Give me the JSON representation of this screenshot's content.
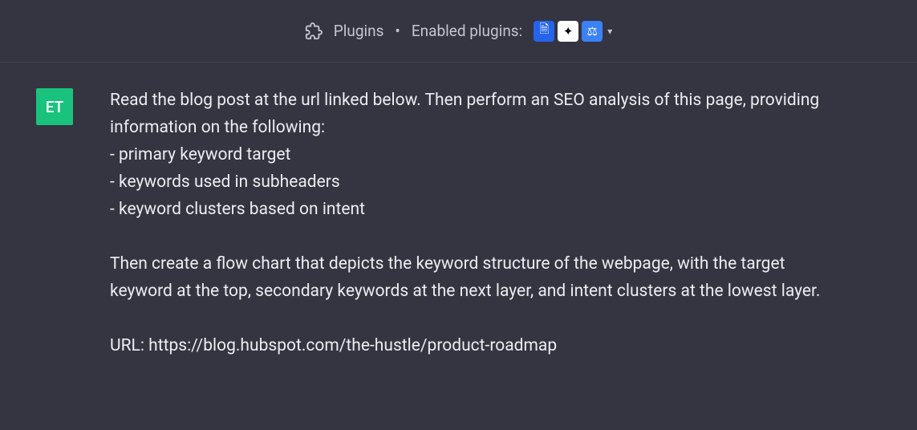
{
  "header": {
    "plugins_label": "Plugins",
    "enabled_label": "Enabled plugins:",
    "plugin_icons": {
      "icon1_glyph": "🗎",
      "icon2_glyph": "✦",
      "icon3_glyph": "⚖"
    }
  },
  "message": {
    "avatar_initials": "ET",
    "intro_line1": "Read the blog post at the url linked below. Then perform an SEO analysis of this page, providing information on the following:",
    "bullet1": "- primary keyword target",
    "bullet2": "- keywords used in subheaders",
    "bullet3": "- keyword clusters based on intent",
    "para2": "Then create a flow chart that depicts the keyword structure of the webpage, with the target keyword at the top, secondary keywords at the next layer, and intent clusters at the lowest layer.",
    "url_line": "URL: https://blog.hubspot.com/the-hustle/product-roadmap"
  }
}
